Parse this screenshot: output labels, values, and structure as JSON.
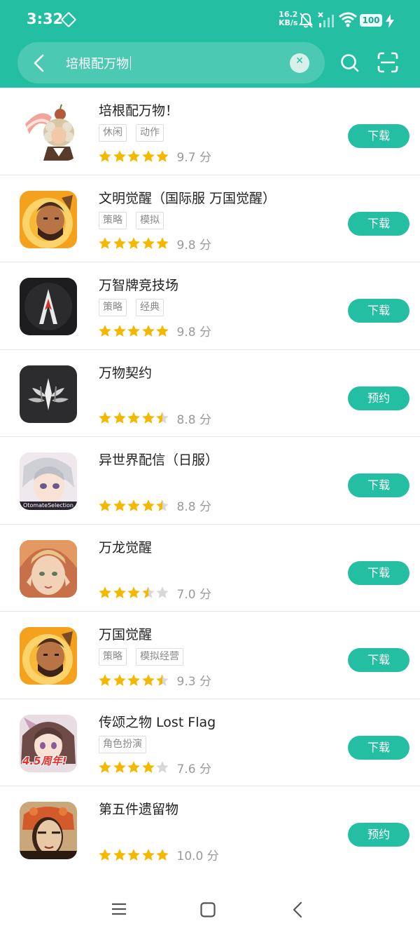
{
  "status_bar": {
    "time": "3:32",
    "net_speed": "16.2",
    "net_unit": "KB/s",
    "battery": "100"
  },
  "search": {
    "query": "培根配万物"
  },
  "star_color": "#f5b800",
  "star_empty_color": "#d8d8d8",
  "accent": "#24bea2",
  "apps": [
    {
      "name": "培根配万物！",
      "tags": [
        "休闲",
        "动作"
      ],
      "rating": 5,
      "score": "9.7 分",
      "button": "下载",
      "icon": "bacon-man-icon"
    },
    {
      "name": "文明觉醒（国际服 万国觉醒）",
      "tags": [
        "策略",
        "模拟"
      ],
      "rating": 5,
      "score": "9.8 分",
      "button": "下载",
      "icon": "warrior-icon"
    },
    {
      "name": "万智牌竞技场",
      "tags": [
        "策略",
        "经典"
      ],
      "rating": 5,
      "score": "9.8 分",
      "button": "下载",
      "icon": "arena-icon"
    },
    {
      "name": "万物契约",
      "tags": [],
      "rating": 4.5,
      "score": "8.8 分",
      "button": "预约",
      "icon": "leaf-emblem-icon"
    },
    {
      "name": "异世界配信（日服）",
      "tags": [],
      "rating": 4.5,
      "score": "8.8 分",
      "button": "下载",
      "icon": "anime-boy-icon",
      "icon_caption": "OtomateSelection"
    },
    {
      "name": "万龙觉醒",
      "tags": [],
      "rating": 3.5,
      "score": "7.0 分",
      "button": "下载",
      "icon": "elf-icon"
    },
    {
      "name": "万国觉醒",
      "tags": [
        "策略",
        "模拟经营"
      ],
      "rating": 4.5,
      "score": "9.3 分",
      "button": "下载",
      "icon": "warrior-icon"
    },
    {
      "name": "传颂之物 Lost Flag",
      "tags": [
        "角色扮演"
      ],
      "rating": 4,
      "score": "7.6 分",
      "button": "下载",
      "icon": "anime-girl-icon",
      "icon_badge": "4.5周年!"
    },
    {
      "name": "第五件遗留物",
      "tags": [],
      "rating": 5,
      "score": "10.0 分",
      "button": "预约",
      "icon": "painted-face-icon"
    }
  ]
}
